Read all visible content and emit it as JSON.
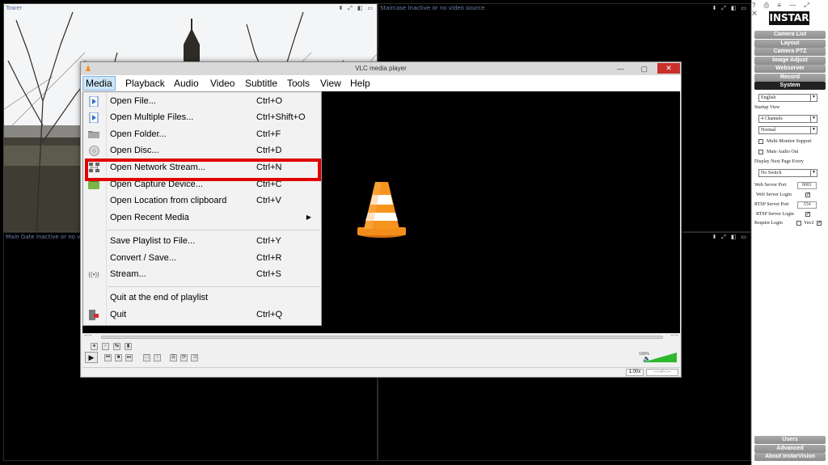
{
  "cameras": [
    {
      "label": "Tower",
      "tools": "⬍ ⤢ ◧ ▭"
    },
    {
      "label": "Staircase Inactive or no video source",
      "tools": "⬍ ⤢ ◧ ▭"
    },
    {
      "label": "Main Gate Inactive or no vi",
      "tools": ""
    },
    {
      "label": "",
      "tools": "⬍ ⤢ ◧ ▭"
    }
  ],
  "panel": {
    "window_controls": "? ⎙ ≡ — ⤢ ✕",
    "logo": "INSTAR",
    "nav": [
      "Camera List",
      "Layout",
      "Camera PTZ",
      "Image Adjust",
      "Webserver",
      "Record",
      "System"
    ],
    "active_nav": "System",
    "language": "English",
    "startup_view_label": "Startup View",
    "startup_view": "4 Channels",
    "window_mode": "Normal",
    "multi_monitor_label": "Multi-Monitor Support",
    "mute_audio_label": "Mute Audio Out",
    "display_next_label": "Display Next Page Every",
    "display_next": "No Switch",
    "web_server_port_label": "Web Server Port",
    "web_server_port": "8081",
    "web_server_login_label": "Web Server Login",
    "rtsp_port_label": "RTSP Server Port",
    "rtsp_port": "554",
    "rtsp_login_label": "RTSP Server Login",
    "require_login_label": "Require Login",
    "yuv2_label": "Yuv2",
    "bottom": [
      "Users",
      "Advanced",
      "About InstarVision"
    ]
  },
  "vlc": {
    "title": "VLC media player",
    "window_controls": "— ▢",
    "close": "✕",
    "menu": [
      "Media",
      "Playback",
      "Audio",
      "Video",
      "Subtitle",
      "Tools",
      "View",
      "Help"
    ],
    "open_menu": "Media",
    "time_left": "--:--",
    "time_right": "--:--",
    "volume_pct": "100%",
    "speed": "1.00x",
    "time_status": "--:--/--:--"
  },
  "media_menu": {
    "items": [
      {
        "label": "Open File...",
        "shortcut": "Ctrl+O",
        "icon": "file-play-icon"
      },
      {
        "label": "Open Multiple Files...",
        "shortcut": "Ctrl+Shift+O",
        "icon": "files-play-icon"
      },
      {
        "label": "Open Folder...",
        "shortcut": "Ctrl+F",
        "icon": "folder-icon"
      },
      {
        "label": "Open Disc...",
        "shortcut": "Ctrl+D",
        "icon": "disc-icon"
      },
      {
        "label": "Open Network Stream...",
        "shortcut": "Ctrl+N",
        "icon": "network-icon"
      },
      {
        "label": "Open Capture Device...",
        "shortcut": "Ctrl+C",
        "icon": "capture-device-icon"
      },
      {
        "label": "Open Location from clipboard",
        "shortcut": "Ctrl+V",
        "icon": ""
      },
      {
        "label": "Open Recent Media",
        "shortcut": "",
        "icon": "",
        "submenu": "▶"
      },
      {
        "label": "Save Playlist to File...",
        "shortcut": "Ctrl+Y",
        "icon": ""
      },
      {
        "label": "Convert / Save...",
        "shortcut": "Ctrl+R",
        "icon": ""
      },
      {
        "label": "Stream...",
        "shortcut": "Ctrl+S",
        "icon": "stream-icon"
      },
      {
        "label": "Quit at the end of playlist",
        "shortcut": "",
        "icon": ""
      },
      {
        "label": "Quit",
        "shortcut": "Ctrl+Q",
        "icon": "quit-icon"
      }
    ],
    "highlighted": "Open Network Stream..."
  },
  "accent": {
    "highlight_red": "#e00000",
    "vlc_orange": "#f28c1b",
    "menu_open_bg": "#cde5f7"
  }
}
